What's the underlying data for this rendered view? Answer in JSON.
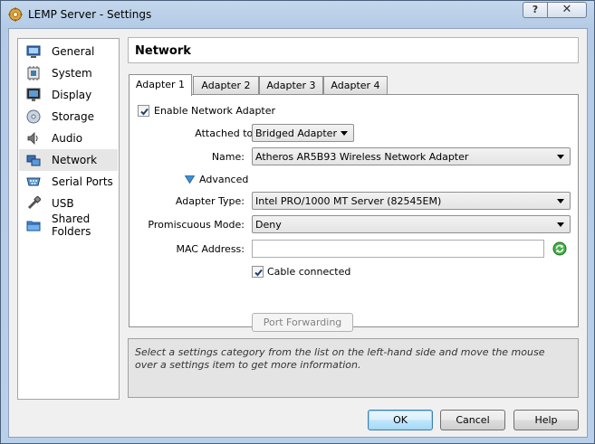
{
  "window": {
    "title": "LEMP Server - Settings",
    "help_label": "?",
    "close_label": "✕"
  },
  "sidebar": {
    "items": [
      {
        "label": "General",
        "icon": "general-icon"
      },
      {
        "label": "System",
        "icon": "system-icon"
      },
      {
        "label": "Display",
        "icon": "display-icon"
      },
      {
        "label": "Storage",
        "icon": "storage-icon"
      },
      {
        "label": "Audio",
        "icon": "audio-icon"
      },
      {
        "label": "Network",
        "icon": "network-icon",
        "active": true
      },
      {
        "label": "Serial Ports",
        "icon": "serial-ports-icon"
      },
      {
        "label": "USB",
        "icon": "usb-icon"
      },
      {
        "label": "Shared Folders",
        "icon": "shared-folders-icon"
      }
    ]
  },
  "header": {
    "title": "Network"
  },
  "tabs": [
    {
      "label": "Adapter 1",
      "active": true
    },
    {
      "label": "Adapter 2"
    },
    {
      "label": "Adapter 3"
    },
    {
      "label": "Adapter 4"
    }
  ],
  "adapter": {
    "enable_label": "Enable Network Adapter",
    "enable_checked": true,
    "attached_label": "Attached to:",
    "attached_value": "Bridged Adapter",
    "name_label": "Name:",
    "name_value": "Atheros AR5B93 Wireless Network Adapter",
    "advanced_label": "Advanced",
    "adapter_type_label": "Adapter Type:",
    "adapter_type_value": "Intel PRO/1000 MT Server (82545EM)",
    "promiscuous_label": "Promiscuous Mode:",
    "promiscuous_value": "Deny",
    "mac_label": "MAC Address:",
    "mac_value": "",
    "cable_label": "Cable connected",
    "cable_checked": true,
    "port_forwarding_label": "Port Forwarding"
  },
  "info": {
    "text": "Select a settings category from the list on the left-hand side and move the mouse over a settings item to get more information."
  },
  "buttons": {
    "ok": "OK",
    "cancel": "Cancel",
    "help": "Help"
  },
  "colors": {
    "accent": "#3c7fb1",
    "refresh": "#2e9a2e",
    "advanced_arrow": "#3a8fd6"
  }
}
